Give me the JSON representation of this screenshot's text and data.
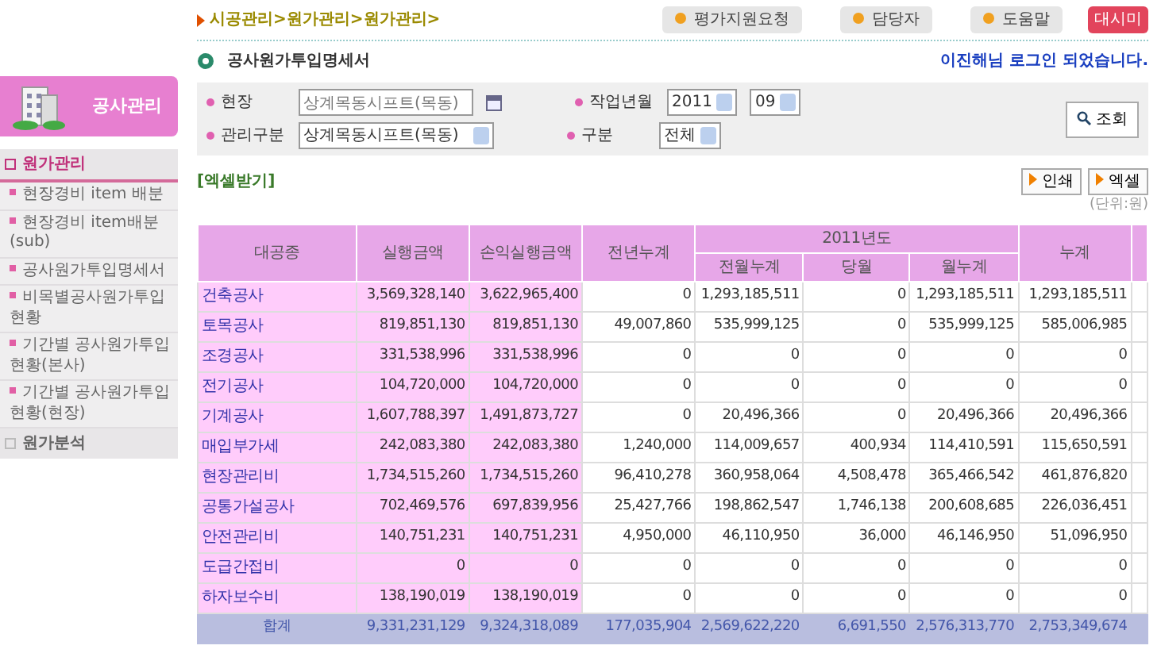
{
  "breadcrumb": "시공관리>원가관리>원가관리>",
  "top_buttons": [
    {
      "label": "평가지원요청",
      "kind": "normal"
    },
    {
      "label": "담당자",
      "kind": "normal"
    },
    {
      "label": "도움말",
      "kind": "normal"
    },
    {
      "label": "대시미",
      "kind": "alert"
    }
  ],
  "page_title": "공사원가투입명세서",
  "login_message": "이진해님 로그인 되었습니다.",
  "sidebar": {
    "title": "공사관리",
    "sections": [
      {
        "label": "원가관리",
        "expanded": true,
        "items": [
          "현장경비 item 배분",
          "현장경비 item배분(sub)",
          "공사원가투입명세서",
          "비목별공사원가투입현황",
          "기간별 공사원가투입현황(본사)",
          "기간별 공사원가투입현황(현장)"
        ]
      },
      {
        "label": "원가분석",
        "expanded": false
      }
    ]
  },
  "filters": {
    "site_label": "현장",
    "site_value": "상계목동시프트(목동)",
    "manage_label": "관리구분",
    "manage_value": "상계목동시프트(목동)",
    "period_label": "작업년월",
    "year": "2011",
    "month": "09",
    "type_label": "구분",
    "type_value": "전체",
    "search_button": "조회"
  },
  "excel_link": "[엑셀받기]",
  "action_buttons": [
    "인쇄",
    "엑셀"
  ],
  "unit_note": "(단위:원)",
  "table": {
    "columns": [
      "대공종",
      "실행금액",
      "손익실행금액",
      "전년누계",
      "누계"
    ],
    "group_label": "2011년도",
    "group_columns": [
      "전월누계",
      "당월",
      "월누계"
    ],
    "rows": [
      {
        "kind": "item",
        "name": "건축공사",
        "values": [
          "3,569,328,140",
          "3,622,965,400",
          "0",
          "1,293,185,511",
          "0",
          "1,293,185,511",
          "1,293,185,511"
        ]
      },
      {
        "kind": "item",
        "name": "토목공사",
        "values": [
          "819,851,130",
          "819,851,130",
          "49,007,860",
          "535,999,125",
          "0",
          "535,999,125",
          "585,006,985"
        ]
      },
      {
        "kind": "item",
        "name": "조경공사",
        "values": [
          "331,538,996",
          "331,538,996",
          "0",
          "0",
          "0",
          "0",
          "0"
        ]
      },
      {
        "kind": "item",
        "name": "전기공사",
        "values": [
          "104,720,000",
          "104,720,000",
          "0",
          "0",
          "0",
          "0",
          "0"
        ]
      },
      {
        "kind": "item",
        "name": "기계공사",
        "values": [
          "1,607,788,397",
          "1,491,873,727",
          "0",
          "20,496,366",
          "0",
          "20,496,366",
          "20,496,366"
        ]
      },
      {
        "kind": "item",
        "name": "매입부가세",
        "values": [
          "242,083,380",
          "242,083,380",
          "1,240,000",
          "114,009,657",
          "400,934",
          "114,410,591",
          "115,650,591"
        ]
      },
      {
        "kind": "item",
        "name": "현장관리비",
        "values": [
          "1,734,515,260",
          "1,734,515,260",
          "96,410,278",
          "360,958,064",
          "4,508,478",
          "365,466,542",
          "461,876,820"
        ]
      },
      {
        "kind": "item",
        "name": "공통가설공사",
        "values": [
          "702,469,576",
          "697,839,956",
          "25,427,766",
          "198,862,547",
          "1,746,138",
          "200,608,685",
          "226,036,451"
        ]
      },
      {
        "kind": "item",
        "name": "안전관리비",
        "values": [
          "140,751,231",
          "140,751,231",
          "4,950,000",
          "46,110,950",
          "36,000",
          "46,146,950",
          "51,096,950"
        ]
      },
      {
        "kind": "item",
        "name": "도급간접비",
        "values": [
          "0",
          "0",
          "0",
          "0",
          "0",
          "0",
          "0"
        ]
      },
      {
        "kind": "item",
        "name": "하자보수비",
        "values": [
          "138,190,019",
          "138,190,019",
          "0",
          "0",
          "0",
          "0",
          "0"
        ]
      },
      {
        "kind": "total",
        "name": "합계",
        "values": [
          "9,331,231,129",
          "9,324,318,089",
          "177,035,904",
          "2,569,622,220",
          "6,691,550",
          "2,576,313,770",
          "2,753,349,674"
        ]
      }
    ]
  }
}
